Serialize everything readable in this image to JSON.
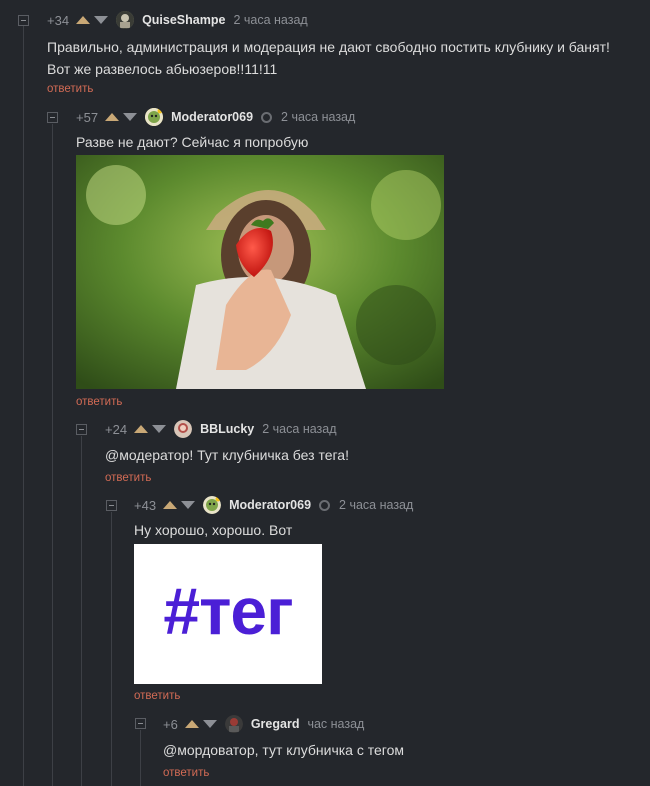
{
  "comments": [
    {
      "rating": "+34",
      "author": "QuiseShampe",
      "time": "2 часа назад",
      "text": "Правильно, администрация и модерация не дают свободно постить клубнику и банят! Вот же развелось абьюзеров!!11!11",
      "reply": "ответить"
    },
    {
      "rating": "+57",
      "author": "Moderator069",
      "time": "2 часа назад",
      "text": "Разве не дают? Сейчас я попробую",
      "reply": "ответить"
    },
    {
      "rating": "+24",
      "author": "BBLucky",
      "time": "2 часа назад",
      "text": "@модератор! Тут клубничка без тега!",
      "reply": "ответить"
    },
    {
      "rating": "+43",
      "author": "Moderator069",
      "time": "2 часа назад",
      "text": "Ну хорошо, хорошо. Вот",
      "image_text": "#тег",
      "reply": "ответить"
    },
    {
      "rating": "+6",
      "author": "Gregard",
      "time": "час назад",
      "text": "@мордоватор, тут клубничка с тегом",
      "reply": "ответить"
    }
  ],
  "colors": {
    "background": "#24272c",
    "reply_link": "#d26b55",
    "upvote": "#c9a876",
    "tag_purple": "#4b1fd6"
  },
  "icons": [
    "collapse-icon",
    "upvote-icon",
    "downvote-icon",
    "moderator-badge-icon"
  ]
}
